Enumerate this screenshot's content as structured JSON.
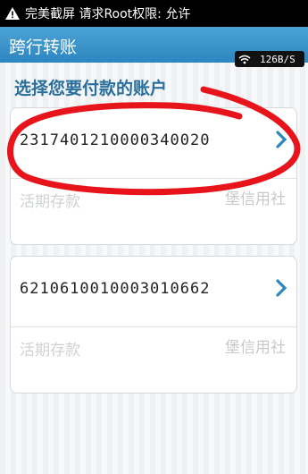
{
  "status_bar": {
    "text": "完美截屏 请求Root权限: 允许"
  },
  "header": {
    "title": "跨行转账",
    "net_speed": "126B/S"
  },
  "section_title": "选择您要付款的账户",
  "accounts": [
    {
      "number": "2317401210000340020",
      "type": "活期存款",
      "bank": "堡信用社"
    },
    {
      "number": "6210610010003010662",
      "type": "活期存款",
      "bank": "堡信用社"
    }
  ],
  "colors": {
    "header": "#2e86c1",
    "section_title": "#2a6f9c",
    "chevron": "#2e86c1",
    "annotation": "#e8141b"
  }
}
